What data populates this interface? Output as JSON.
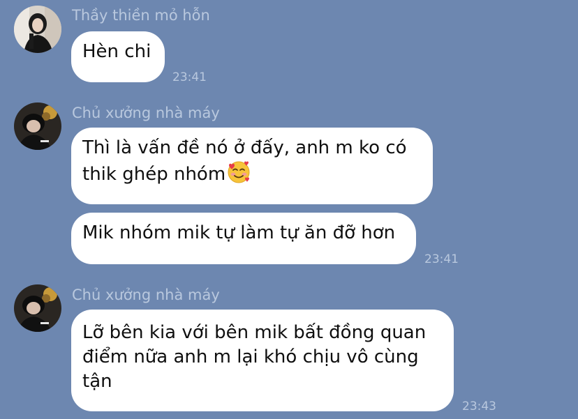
{
  "chat": {
    "messages": [
      {
        "sender": "Thầy thiền mỏ hỗn",
        "avatar": "avatar-girl-photo",
        "bubbles": [
          {
            "text": "Hèn chi",
            "time": "23:41"
          }
        ]
      },
      {
        "sender": "Chủ xưởng nhà máy",
        "avatar": "avatar-boy-photo",
        "bubbles": [
          {
            "line1": "Thì là vấn đề nó ở đấy, anh m ko có",
            "line2": "thik ghép nhóm",
            "emoji": "smiling-face-with-hearts-emoji"
          },
          {
            "text": "Mik nhóm mik tự làm tự ăn đỡ hơn",
            "time": "23:41"
          }
        ]
      },
      {
        "sender": "Chủ xưởng nhà máy",
        "avatar": "avatar-boy-photo",
        "bubbles": [
          {
            "line1": "Lỡ bên kia với bên mik bất đồng quan",
            "line2": "điểm nữa anh m lại khó chịu vô cùng",
            "line3": "tận",
            "time": "23:43"
          }
        ]
      }
    ]
  },
  "colors": {
    "background": "#6d87b0",
    "bubble": "#ffffff",
    "meta_text": "#b9c8de",
    "message_text": "#0f0f0f"
  }
}
